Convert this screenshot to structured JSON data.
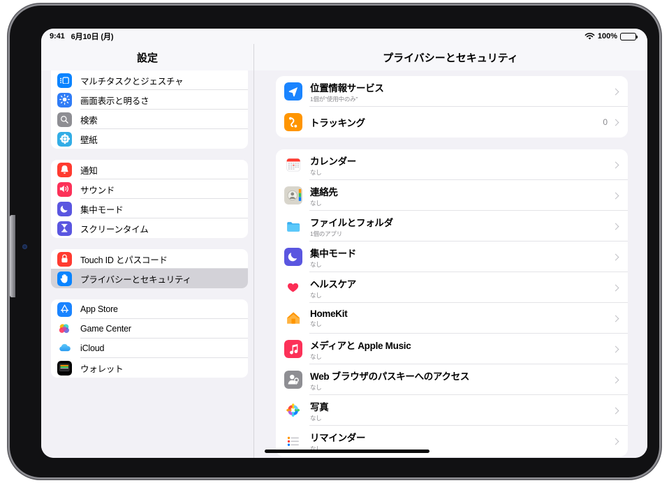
{
  "status_bar": {
    "time": "9:41",
    "date": "6月10日 (月)",
    "wifi_icon": "wifi-icon",
    "battery_percent": "100%",
    "battery_icon": "battery-full-icon"
  },
  "sidebar": {
    "title": "設定",
    "groups": [
      {
        "items": [
          {
            "label": "マルチタスクとジェスチャ",
            "icon": "multitasking-icon",
            "selected": false
          },
          {
            "label": "画面表示と明るさ",
            "icon": "brightness-icon",
            "selected": false
          },
          {
            "label": "検索",
            "icon": "search-icon",
            "selected": false
          },
          {
            "label": "壁紙",
            "icon": "wallpaper-icon",
            "selected": false
          }
        ]
      },
      {
        "items": [
          {
            "label": "通知",
            "icon": "notifications-bell-icon",
            "selected": false
          },
          {
            "label": "サウンド",
            "icon": "sound-speaker-icon",
            "selected": false
          },
          {
            "label": "集中モード",
            "icon": "focus-moon-icon",
            "selected": false
          },
          {
            "label": "スクリーンタイム",
            "icon": "screen-time-hourglass-icon",
            "selected": false
          }
        ]
      },
      {
        "items": [
          {
            "label": "Touch ID とパスコード",
            "icon": "touch-id-lock-icon",
            "selected": false
          },
          {
            "label": "プライバシーとセキュリティ",
            "icon": "privacy-hand-icon",
            "selected": true
          }
        ]
      },
      {
        "items": [
          {
            "label": "App Store",
            "icon": "app-store-icon",
            "selected": false
          },
          {
            "label": "Game Center",
            "icon": "game-center-icon",
            "selected": false
          },
          {
            "label": "iCloud",
            "icon": "icloud-icon",
            "selected": false
          },
          {
            "label": "ウォレット",
            "icon": "wallet-icon",
            "selected": false
          }
        ]
      }
    ]
  },
  "detail": {
    "title": "プライバシーとセキュリティ",
    "groups": [
      {
        "rows": [
          {
            "title": "位置情報サービス",
            "subtitle": "1個が\"使用中のみ\"",
            "value": "",
            "icon": "location-arrow-icon"
          },
          {
            "title": "トラッキング",
            "subtitle": "",
            "value": "0",
            "icon": "tracking-icon"
          }
        ]
      },
      {
        "rows": [
          {
            "title": "カレンダー",
            "subtitle": "なし",
            "value": "",
            "icon": "calendar-icon"
          },
          {
            "title": "連絡先",
            "subtitle": "なし",
            "value": "",
            "icon": "contacts-icon"
          },
          {
            "title": "ファイルとフォルダ",
            "subtitle": "1個のアプリ",
            "value": "",
            "icon": "files-folder-icon"
          },
          {
            "title": "集中モード",
            "subtitle": "なし",
            "value": "",
            "icon": "focus-moon-icon"
          },
          {
            "title": "ヘルスケア",
            "subtitle": "なし",
            "value": "",
            "icon": "health-heart-icon"
          },
          {
            "title": "HomeKit",
            "subtitle": "なし",
            "value": "",
            "icon": "homekit-house-icon"
          },
          {
            "title": "メディアと Apple Music",
            "subtitle": "なし",
            "value": "",
            "icon": "apple-music-icon"
          },
          {
            "title": "Web ブラウザのパスキーへのアクセス",
            "subtitle": "なし",
            "value": "",
            "icon": "passkey-person-icon"
          },
          {
            "title": "写真",
            "subtitle": "なし",
            "value": "",
            "icon": "photos-icon"
          },
          {
            "title": "リマインダー",
            "subtitle": "なし",
            "value": "",
            "icon": "reminders-icon"
          }
        ]
      }
    ]
  },
  "colors": {
    "accent_blue": "#007aff",
    "orange": "#ff9500",
    "red": "#ff3b30",
    "purple": "#5e5ce6",
    "selected_row": "#d3d2d8",
    "background": "#f2f1f6"
  },
  "home_indicator": "home-indicator"
}
